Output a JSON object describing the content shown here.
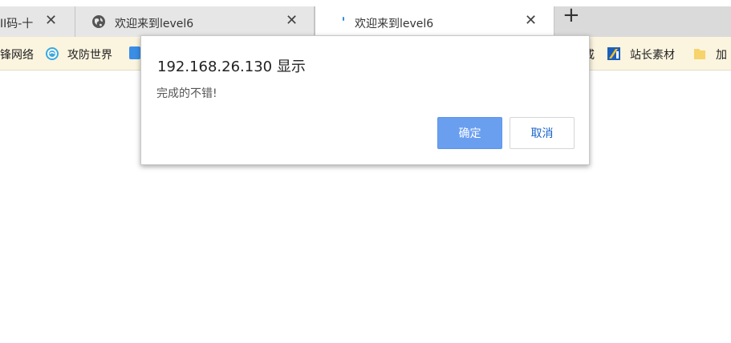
{
  "tabs": [
    {
      "title": "II码-十",
      "close": "✕"
    },
    {
      "title": "欢迎来到level6",
      "close": "✕"
    },
    {
      "title": "欢迎来到level6",
      "close": "✕"
    }
  ],
  "new_tab": "+",
  "bookmarks": [
    {
      "label": "锋网络"
    },
    {
      "label": "攻防世界"
    },
    {
      "label": "戒"
    },
    {
      "label": "站长素材"
    },
    {
      "label": "加"
    }
  ],
  "dialog": {
    "title": "192.168.26.130 显示",
    "message": "完成的不错!",
    "ok": "确定",
    "cancel": "取消"
  },
  "colors": {
    "accent": "#6a9ff0",
    "link": "#1a63c9",
    "bookmark_bar": "#fbf4df"
  }
}
